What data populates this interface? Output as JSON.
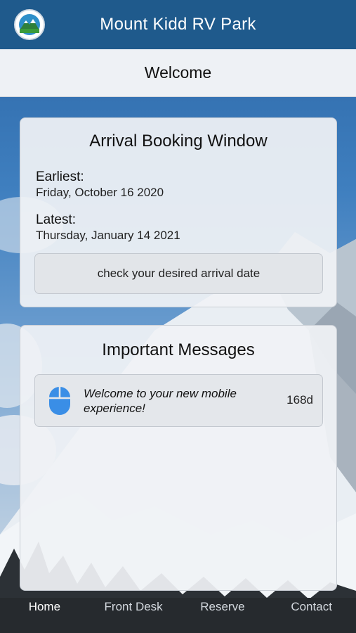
{
  "header": {
    "title": "Mount Kidd RV Park",
    "logo_icon": "mountain-logo-icon"
  },
  "subheader": {
    "title": "Welcome"
  },
  "booking": {
    "title": "Arrival Booking Window",
    "earliest_label": "Earliest:",
    "earliest_value": "Friday, October 16 2020",
    "latest_label": "Latest:",
    "latest_value": "Thursday, January 14 2021",
    "check_button_label": "check your desired arrival date"
  },
  "messages": {
    "title": "Important Messages",
    "items": [
      {
        "icon": "mouse-icon",
        "text": "Welcome to your new mobile experience!",
        "age": "168d"
      }
    ]
  },
  "tabbar": {
    "tabs": [
      {
        "label": "Home",
        "active": true
      },
      {
        "label": "Front Desk",
        "active": false
      },
      {
        "label": "Reserve",
        "active": false
      },
      {
        "label": "Contact",
        "active": false
      }
    ]
  },
  "colors": {
    "header_bg": "#1f5a8c",
    "accent_blue": "#3a8ee6"
  }
}
